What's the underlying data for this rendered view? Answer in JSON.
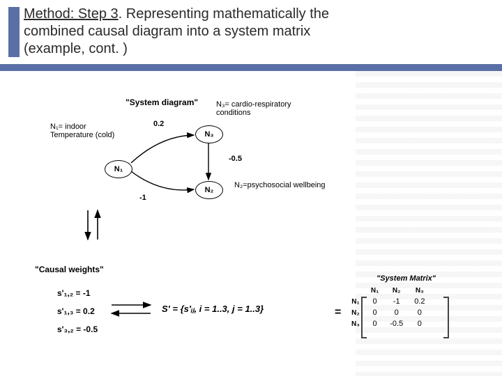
{
  "colors": {
    "accent": "#5a6fa6"
  },
  "title": {
    "underlined": "Method: Step 3",
    "rest": ". Representing mathematically the combined causal diagram into a system matrix (example, cont. )"
  },
  "diagram": {
    "heading": "\"System diagram\"",
    "nodes": {
      "N1": {
        "id": "N1",
        "label": "N₁",
        "desc": "N₁= indoor Temperature (cold)"
      },
      "N2": {
        "id": "N2",
        "label": "N₂",
        "desc": "N₂=psychosocial wellbeing"
      },
      "N3": {
        "id": "N3",
        "label": "N₃",
        "desc": "N₃= cardio-respiratory conditions"
      }
    },
    "edge_weights": {
      "N1_N3": "0.2",
      "N3_N2": "-0.5",
      "N1_N2": "-1"
    }
  },
  "causal_weights": {
    "heading": "\"Causal weights\"",
    "items": [
      {
        "key": "s'₁,₂",
        "val": "= -1"
      },
      {
        "key": "s'₁,₃",
        "val": "= 0.2"
      },
      {
        "key": "s'₃,₂",
        "val": "= -0.5"
      }
    ]
  },
  "system_formula": "S' = {s'ᵢⱼ,   i = 1..3,     j = 1..3}",
  "system_matrix": {
    "heading": "\"System Matrix\"",
    "col_headers": [
      "N₁",
      "N₂",
      "N₃"
    ],
    "row_headers": [
      "N₁",
      "N₂",
      "N₃"
    ],
    "rows": [
      [
        "0",
        "-1",
        "0.2"
      ],
      [
        "0",
        "0",
        "0"
      ],
      [
        "0",
        "-0.5",
        "0"
      ]
    ]
  }
}
